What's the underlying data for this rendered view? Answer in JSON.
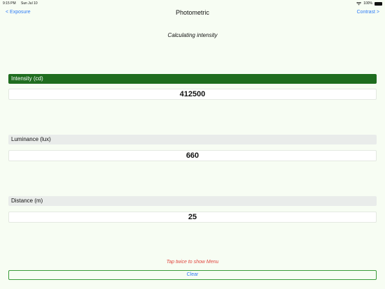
{
  "status_bar": {
    "time": "9:15 PM",
    "date": "Sun Jul 10",
    "battery": "100%"
  },
  "nav": {
    "back_label": "< Exposure",
    "title": "Photometric",
    "next_label": "Contrast >"
  },
  "subtitle": "Calculating intensity",
  "sections": [
    {
      "label": "Intensity (cd)",
      "value": "412500",
      "active": true
    },
    {
      "label": "Luminance (lux)",
      "value": "660",
      "active": false
    },
    {
      "label": "Distance (m)",
      "value": "25",
      "active": false
    }
  ],
  "hint": "Tap twice to show Menu",
  "clear_label": "Clear",
  "colors": {
    "accent_blue": "#2f7cf6",
    "active_header_green": "#1f6d1f",
    "hint_red": "#e0463f"
  }
}
